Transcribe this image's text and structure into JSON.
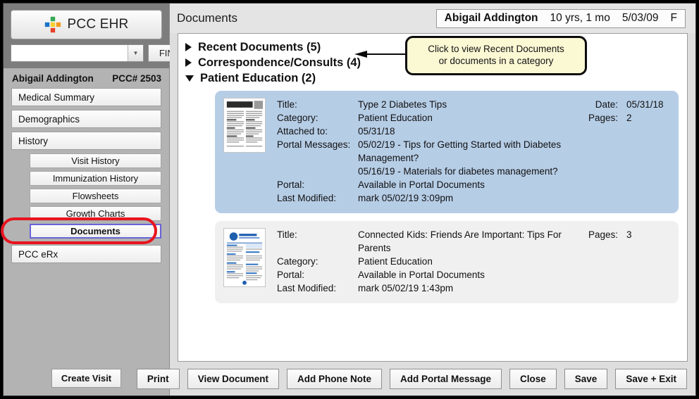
{
  "brand": {
    "app_name": "PCC EHR",
    "logo_icon": "pcc-plus-logo",
    "logo_colors": {
      "top": "#34a853",
      "left": "#1a73c8",
      "center": "#f9cf2e",
      "right": "#f29a1f",
      "bottom": "#e8402a"
    }
  },
  "search": {
    "value": "",
    "placeholder": "",
    "dropdown_icon": "chevron-down-icon",
    "find_label": "FIND"
  },
  "sidebar": {
    "patient_name": "Abigail Addington",
    "patient_id": "PCC# 2503",
    "items": [
      {
        "label": "Medical Summary",
        "type": "top"
      },
      {
        "label": "Demographics",
        "type": "top"
      },
      {
        "label": "History",
        "type": "top"
      },
      {
        "label": "Visit History",
        "type": "sub"
      },
      {
        "label": "Immunization History",
        "type": "sub"
      },
      {
        "label": "Flowsheets",
        "type": "sub"
      },
      {
        "label": "Growth Charts",
        "type": "sub"
      },
      {
        "label": "Documents",
        "type": "sub",
        "selected": true,
        "annotated": true
      },
      {
        "label": "PCC eRx",
        "type": "top"
      }
    ],
    "create_visit_label": "Create Visit"
  },
  "header": {
    "title": "Documents",
    "patient": {
      "name": "Abigail Addington",
      "age": "10 yrs, 1 mo",
      "dob": "5/03/09",
      "sex": "F"
    }
  },
  "callout": {
    "line1": "Click to view Recent Documents",
    "line2": "or documents in a category",
    "arrow_icon": "left-arrow-icon",
    "background": "#fbf8d4"
  },
  "accordion": [
    {
      "label": "Recent Documents (5)",
      "expanded": false,
      "icon": "triangle-right-icon"
    },
    {
      "label": "Correspondence/Consults (4)",
      "expanded": false,
      "icon": "triangle-right-icon"
    },
    {
      "label": "Patient Education (2)",
      "expanded": true,
      "icon": "triangle-down-icon"
    }
  ],
  "documents": [
    {
      "selected": true,
      "thumbnail_icon": "document-page-thumbnail",
      "fields": [
        {
          "label": "Title:",
          "value": "Type 2 Diabetes Tips"
        },
        {
          "label": "Category:",
          "value": "Patient Education"
        },
        {
          "label": "Attached to:",
          "value": "05/31/18"
        },
        {
          "label": "Portal Messages:",
          "value": "05/02/19 - Tips for Getting Started with Diabetes Management?"
        },
        {
          "label": "",
          "value": "05/16/19 - Materials for diabetes management?",
          "continuation": true
        },
        {
          "label": "Portal:",
          "value": "Available in Portal Documents"
        },
        {
          "label": "Last Modified:",
          "value": "mark 05/02/19 3:09pm"
        }
      ],
      "right_fields": [
        {
          "label": "Date:",
          "value": "05/31/18"
        },
        {
          "label": "Pages:",
          "value": "2"
        }
      ]
    },
    {
      "selected": false,
      "thumbnail_icon": "document-page-thumbnail",
      "fields": [
        {
          "label": "Title:",
          "value": "Connected Kids: Friends Are Important: Tips For Parents"
        },
        {
          "label": "Category:",
          "value": "Patient Education"
        },
        {
          "label": "Portal:",
          "value": "Available in Portal Documents"
        },
        {
          "label": "Last Modified:",
          "value": "mark 05/02/19 1:43pm"
        }
      ],
      "right_fields": [
        {
          "label": "",
          "value": ""
        },
        {
          "label": "Pages:",
          "value": "3"
        }
      ]
    }
  ],
  "footer_buttons": [
    {
      "label": "Print"
    },
    {
      "label": "View Document"
    },
    {
      "label": "Add Phone Note"
    },
    {
      "label": "Add Portal Message"
    },
    {
      "label": "Close"
    },
    {
      "label": "Save"
    },
    {
      "label": "Save + Exit"
    }
  ]
}
